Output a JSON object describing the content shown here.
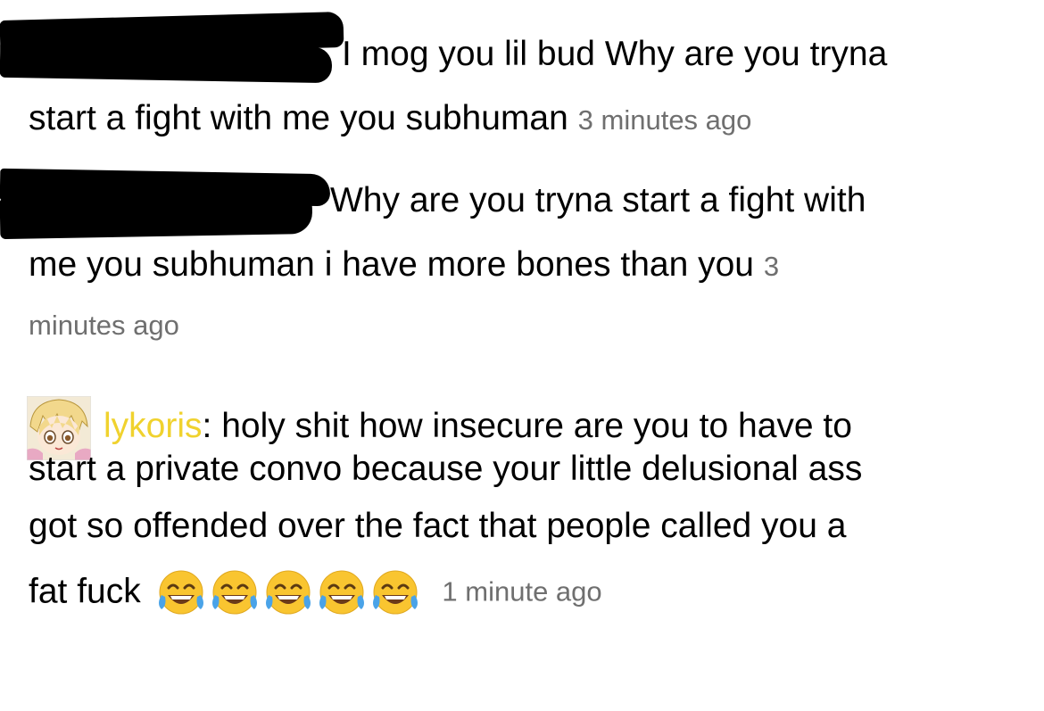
{
  "comments": [
    {
      "text": "I mog you lil bud Why are you tryna",
      "text_cont": "start a fight with me you subhuman",
      "time": "3 minutes ago"
    },
    {
      "text": "Why are you tryna start a fight with",
      "text_cont": "me you subhuman i have more bones than you",
      "time_part1": "3",
      "time_part2": "minutes ago"
    },
    {
      "username": "lykoris",
      "separator": ":",
      "line1": " holy shit how insecure are you to have to",
      "line2": "start a private convo because your little delusional ass",
      "line3": "got so offended over the fact that people called you a",
      "line4": "fat fuck",
      "emoji_count": 5,
      "emoji_name": "face-with-tears-of-joy",
      "time": "1 minute ago"
    }
  ],
  "colors": {
    "username": "#f0d22e",
    "timestamp": "#6f6f6f",
    "redaction": "#000000",
    "emoji_face": "#f9c530",
    "emoji_tear": "#4aa3e8"
  }
}
